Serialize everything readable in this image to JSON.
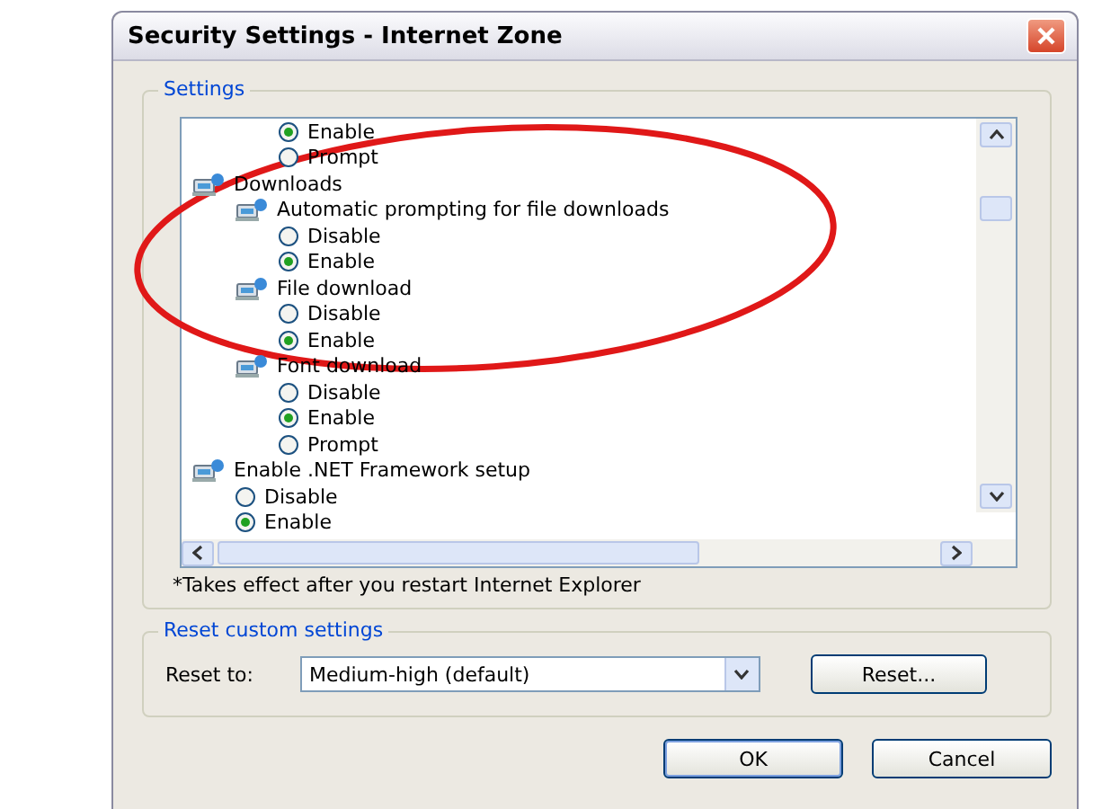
{
  "window": {
    "title": "Security Settings - Internet Zone"
  },
  "settings": {
    "legend": "Settings",
    "tree": [
      {
        "kind": "continued",
        "children": [
          {
            "kind": "continued",
            "children": [
              {
                "kind": "radio",
                "label": "Enable",
                "selected": true
              },
              {
                "kind": "radio",
                "label": "Prompt",
                "selected": false
              }
            ]
          }
        ]
      },
      {
        "kind": "group",
        "label": "Downloads",
        "children": [
          {
            "kind": "group",
            "label": "Automatic prompting for file downloads",
            "children": [
              {
                "kind": "radio",
                "label": "Disable",
                "selected": false
              },
              {
                "kind": "radio",
                "label": "Enable",
                "selected": true
              }
            ]
          },
          {
            "kind": "group",
            "label": "File download",
            "children": [
              {
                "kind": "radio",
                "label": "Disable",
                "selected": false
              },
              {
                "kind": "radio",
                "label": "Enable",
                "selected": true
              }
            ]
          },
          {
            "kind": "group",
            "label": "Font download",
            "children": [
              {
                "kind": "radio",
                "label": "Disable",
                "selected": false
              },
              {
                "kind": "radio",
                "label": "Enable",
                "selected": true
              },
              {
                "kind": "radio",
                "label": "Prompt",
                "selected": false
              }
            ]
          }
        ]
      },
      {
        "kind": "group",
        "label": "Enable .NET Framework setup",
        "children": [
          {
            "kind": "radio",
            "label": "Disable",
            "selected": false
          },
          {
            "kind": "radio",
            "label": "Enable",
            "selected": true
          }
        ]
      }
    ],
    "note": "*Takes effect after you restart Internet Explorer"
  },
  "reset": {
    "legend": "Reset custom settings",
    "label": "Reset to:",
    "value": "Medium-high (default)",
    "button": "Reset..."
  },
  "buttons": [
    "OK",
    "Cancel"
  ]
}
